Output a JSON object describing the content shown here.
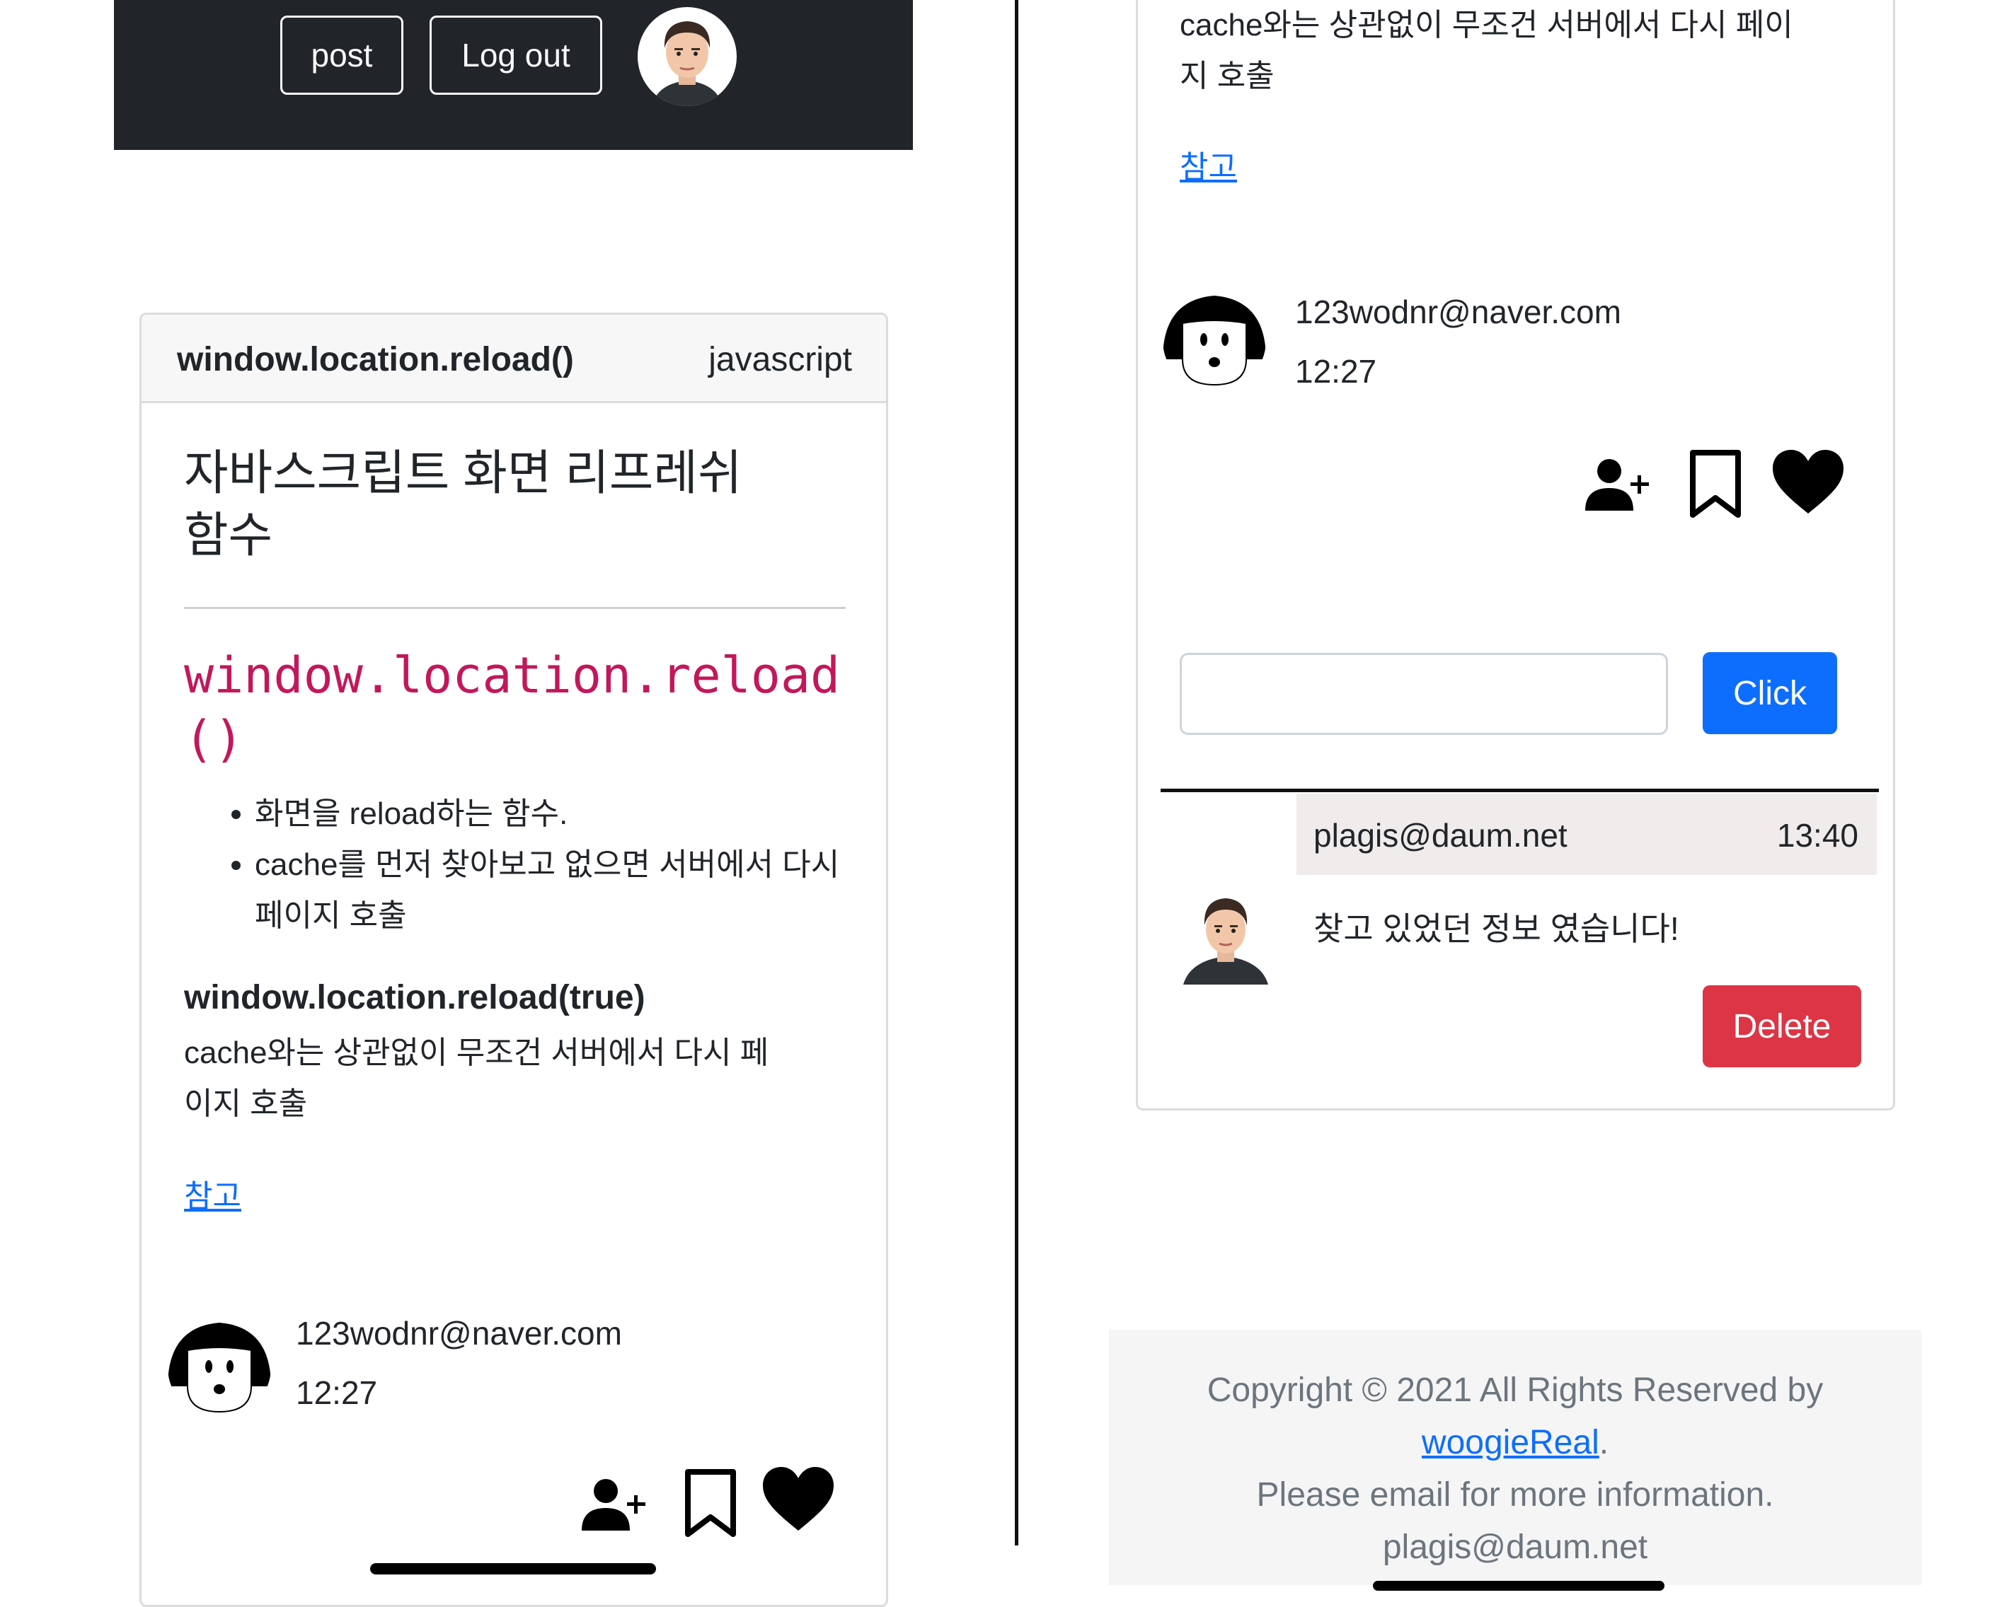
{
  "navbar": {
    "post_label": "post",
    "logout_label": "Log out"
  },
  "post": {
    "title": "window.location.reload()",
    "category": "javascript",
    "heading": "자바스크립트 화면 리프레쉬 함수",
    "code_heading": "window.location.reload()",
    "bullets": [
      "화면을 reload하는 함수.",
      "cache를 먼저 찾아보고 없으면 서버에서 다시 페이지 호출"
    ],
    "bold_line": "window.location.reload(true)",
    "description": "cache와는 상관없이 무조건 서버에서 다시 페이지 호출",
    "ref_link": "참고",
    "author_email": "123wodnr@naver.com",
    "author_time": "12:27"
  },
  "comment_form": {
    "input_value": "",
    "submit_label": "Click"
  },
  "comment": {
    "user": "plagis@daum.net",
    "time": "13:40",
    "text": "찾고 있었던 정보 였습니다!",
    "delete_label": "Delete"
  },
  "footer": {
    "copyright_prefix": "Copyright © 2021 All Rights Reserved by",
    "brand_link": "woogieReal",
    "period": ".",
    "email_note": "Please email for more information.",
    "email": "plagis@daum.net"
  },
  "icons": {
    "follow": "person-plus-icon",
    "bookmark": "bookmark-icon",
    "like": "heart-icon"
  },
  "colors": {
    "navbar_bg": "#212529",
    "primary": "#0d6efd",
    "danger": "#dc3545",
    "code": "#c2185b"
  }
}
